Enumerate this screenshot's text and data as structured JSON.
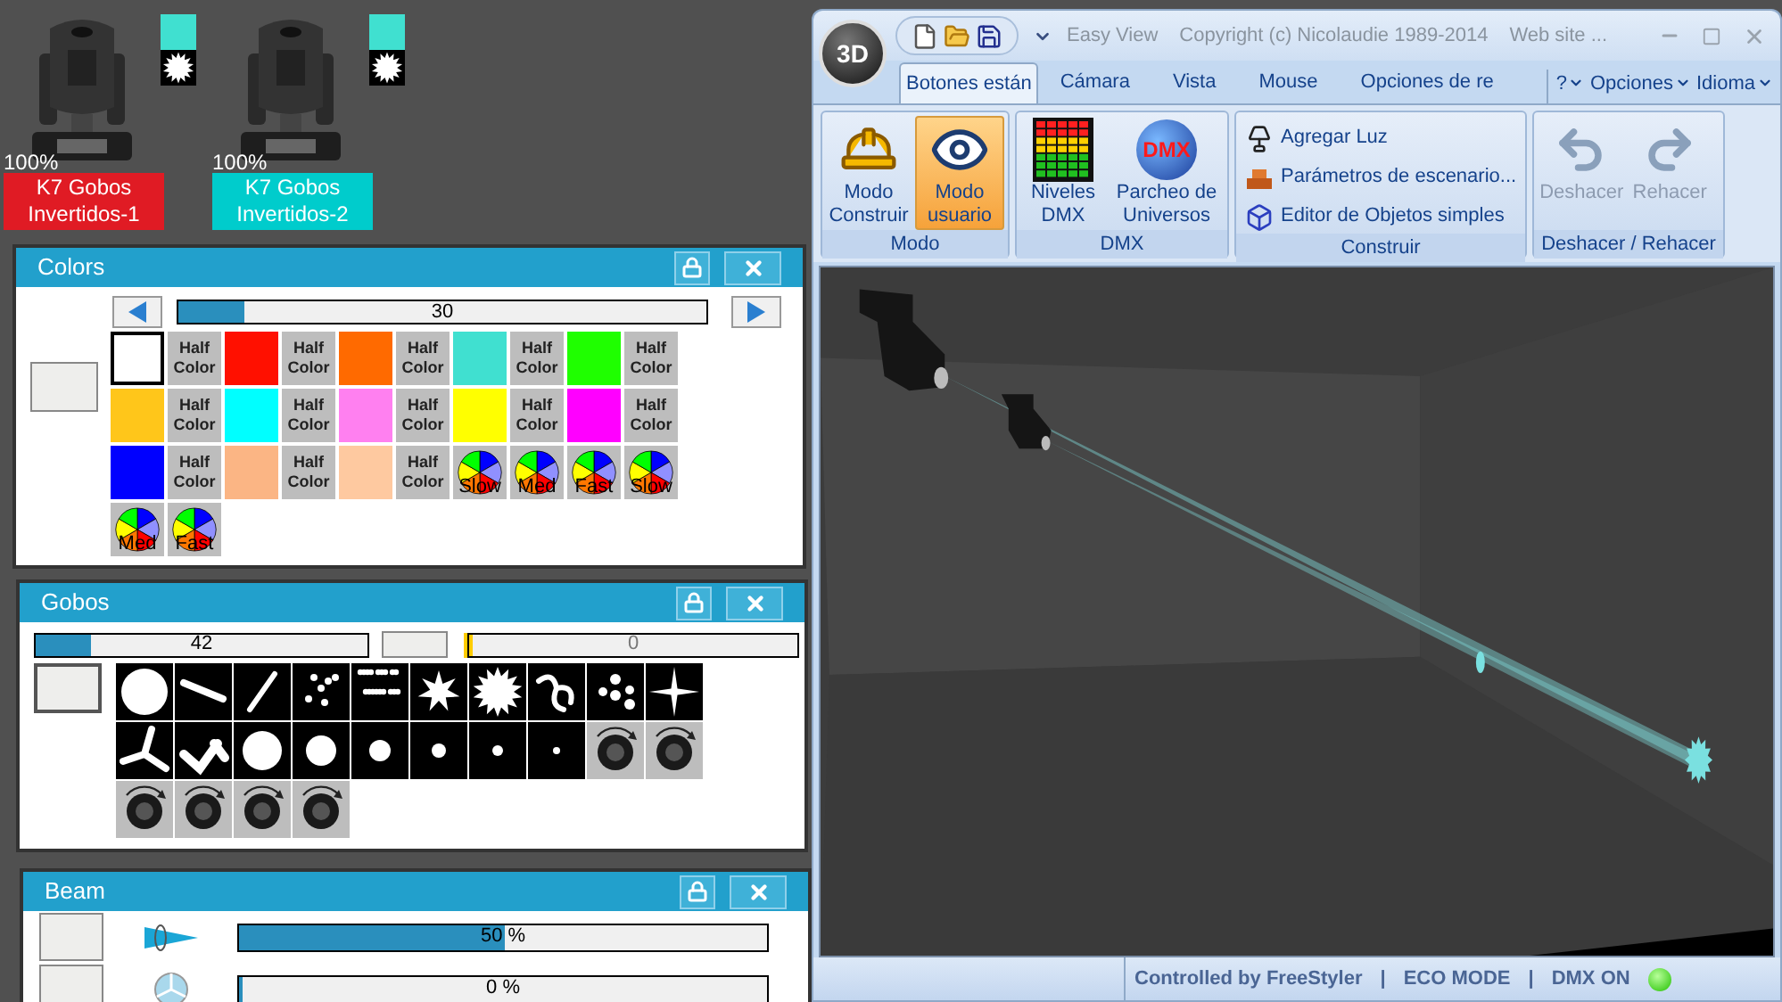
{
  "fixtures": [
    {
      "intensity": "100%",
      "name": "K7 Gobos Invertidos-1",
      "color": "#e01b24",
      "swatch": {
        "color": "#40e0d0"
      }
    },
    {
      "intensity": "100%",
      "name": "K7 Gobos Invertidos-2",
      "color": "#00cccc",
      "swatch": {
        "color": "#40e0d0"
      }
    }
  ],
  "colors_panel": {
    "title": "Colors",
    "slider": {
      "level": 0.12,
      "reading": "30"
    },
    "swatches": [
      {
        "kind": "color",
        "color": "#ffffff",
        "selected": true
      },
      {
        "kind": "half",
        "label": "Half Color"
      },
      {
        "kind": "color",
        "color": "#ff1000",
        "selected": false
      },
      {
        "kind": "half",
        "label": "Half Color"
      },
      {
        "kind": "color",
        "color": "#ff6a00",
        "selected": false
      },
      {
        "kind": "half",
        "label": "Half Color"
      },
      {
        "kind": "color",
        "color": "#40e0d0",
        "selected": false
      },
      {
        "kind": "half",
        "label": "Half Color"
      },
      {
        "kind": "color",
        "color": "#1fff00",
        "selected": false
      },
      {
        "kind": "half",
        "label": "Half Color"
      },
      {
        "kind": "color",
        "color": "#ffc61a",
        "selected": false
      },
      {
        "kind": "half",
        "label": "Half Color"
      },
      {
        "kind": "color",
        "color": "#00ffff",
        "selected": false
      },
      {
        "kind": "half",
        "label": "Half Color"
      },
      {
        "kind": "color",
        "color": "#ff80f0",
        "selected": false
      },
      {
        "kind": "half",
        "label": "Half Color"
      },
      {
        "kind": "color",
        "color": "#ffff00",
        "selected": false
      },
      {
        "kind": "half",
        "label": "Half Color"
      },
      {
        "kind": "color",
        "color": "#ff00ff",
        "selected": false
      },
      {
        "kind": "half",
        "label": "Half Color"
      },
      {
        "kind": "color",
        "color": "#0000ff",
        "selected": false
      },
      {
        "kind": "half",
        "label": "Half Color"
      },
      {
        "kind": "color",
        "color": "#fbb584",
        "selected": false
      },
      {
        "kind": "half",
        "label": "Half Color"
      },
      {
        "kind": "color",
        "color": "#fec9a0",
        "selected": false
      },
      {
        "kind": "half",
        "label": "Half Color"
      },
      {
        "kind": "wheel",
        "label": "Slow"
      },
      {
        "kind": "wheel",
        "label": "Med"
      },
      {
        "kind": "wheel",
        "label": "Fast"
      },
      {
        "kind": "wheel",
        "label": "Slow"
      },
      {
        "kind": "wheel",
        "label": "Med"
      },
      {
        "kind": "wheel",
        "label": "Fast"
      }
    ]
  },
  "gobos_panel": {
    "title": "Gobos",
    "slider": {
      "level": 0.16,
      "reading": "42"
    },
    "rotation_slider": {
      "level": 0,
      "reading": "0"
    },
    "gobos": [
      {
        "kind": "circle"
      },
      {
        "kind": "bar"
      },
      {
        "kind": "slash"
      },
      {
        "kind": "dots"
      },
      {
        "kind": "scatter"
      },
      {
        "kind": "star"
      },
      {
        "kind": "burst"
      },
      {
        "kind": "swirl"
      },
      {
        "kind": "cluster"
      },
      {
        "kind": "sparkle"
      },
      {
        "kind": "tripod"
      },
      {
        "kind": "zigzag"
      },
      {
        "kind": "dot-xl"
      },
      {
        "kind": "dot-lg"
      },
      {
        "kind": "dot-md"
      },
      {
        "kind": "dot-sm"
      },
      {
        "kind": "dot-xs"
      },
      {
        "kind": "dot-xxs"
      },
      {
        "kind": "rotate"
      },
      {
        "kind": "rotate"
      },
      {
        "kind": "rotate"
      },
      {
        "kind": "rotate"
      },
      {
        "kind": "rotate"
      },
      {
        "kind": "rotate"
      }
    ]
  },
  "beam_panel": {
    "title": "Beam",
    "rows": [
      {
        "kind": "focus",
        "level": 0.5,
        "reading": "50 %"
      },
      {
        "kind": "shutter",
        "level": 0,
        "reading": "0 %"
      }
    ]
  },
  "window": {
    "app_button": "3D",
    "title": "Easy View",
    "copyright": "Copyright (c) Nicolaudie 1989-2014",
    "website": "Web site ...",
    "tabs": [
      {
        "label": "Botones están",
        "selected": true
      },
      {
        "label": "Cámara",
        "selected": false
      },
      {
        "label": "Vista",
        "selected": false
      },
      {
        "label": "Mouse",
        "selected": false
      },
      {
        "label": "Opciones de re",
        "selected": false
      }
    ],
    "menus": [
      "?",
      "Opciones",
      "Idioma"
    ],
    "ribbon": [
      {
        "label": "Modo",
        "items": [
          {
            "kind": "helmet",
            "label": "Modo Construir",
            "selected": false
          },
          {
            "kind": "eye",
            "label": "Modo usuario",
            "selected": true
          }
        ]
      },
      {
        "label": "DMX",
        "items": [
          {
            "kind": "meter",
            "label": "Niveles DMX",
            "selected": false
          },
          {
            "kind": "globe",
            "badge": "DMX",
            "label": "Parcheo de Universos",
            "selected": false
          }
        ]
      },
      {
        "label": "Construir",
        "small_items": [
          {
            "kind": "lamp",
            "label": "Agregar Luz"
          },
          {
            "kind": "props",
            "label": "Parámetros de escenario..."
          },
          {
            "kind": "cube",
            "label": "Editor de Objetos simples"
          }
        ]
      },
      {
        "label": "Deshacer / Rehacer",
        "items": [
          {
            "kind": "undo",
            "label": "Deshacer",
            "disabled": true
          },
          {
            "kind": "redo",
            "label": "Rehacer",
            "disabled": true
          }
        ]
      }
    ]
  },
  "status_bar": {
    "items": [
      "Controlled by FreeStyler",
      "|",
      "ECO MODE",
      "|",
      "DMX ON"
    ],
    "led_on": true
  }
}
